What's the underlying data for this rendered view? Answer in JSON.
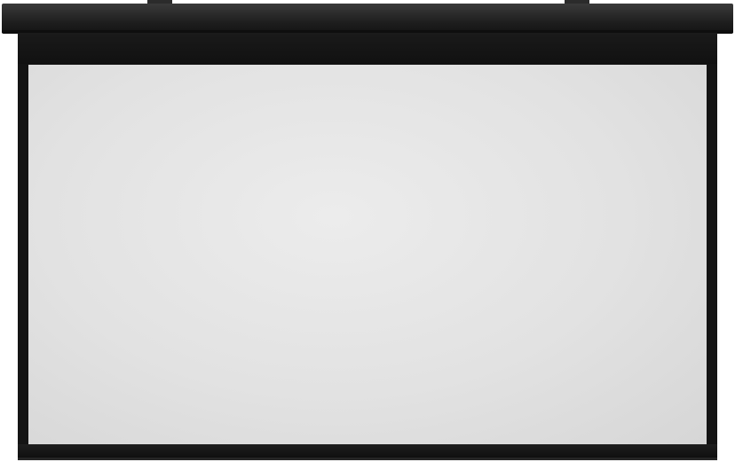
{
  "scene": {
    "subject": "projector-screen",
    "colors": {
      "housing": "#1c1c1c",
      "frame": "#141414",
      "surface": "#e4e4e4",
      "background": "#ffffff"
    }
  }
}
